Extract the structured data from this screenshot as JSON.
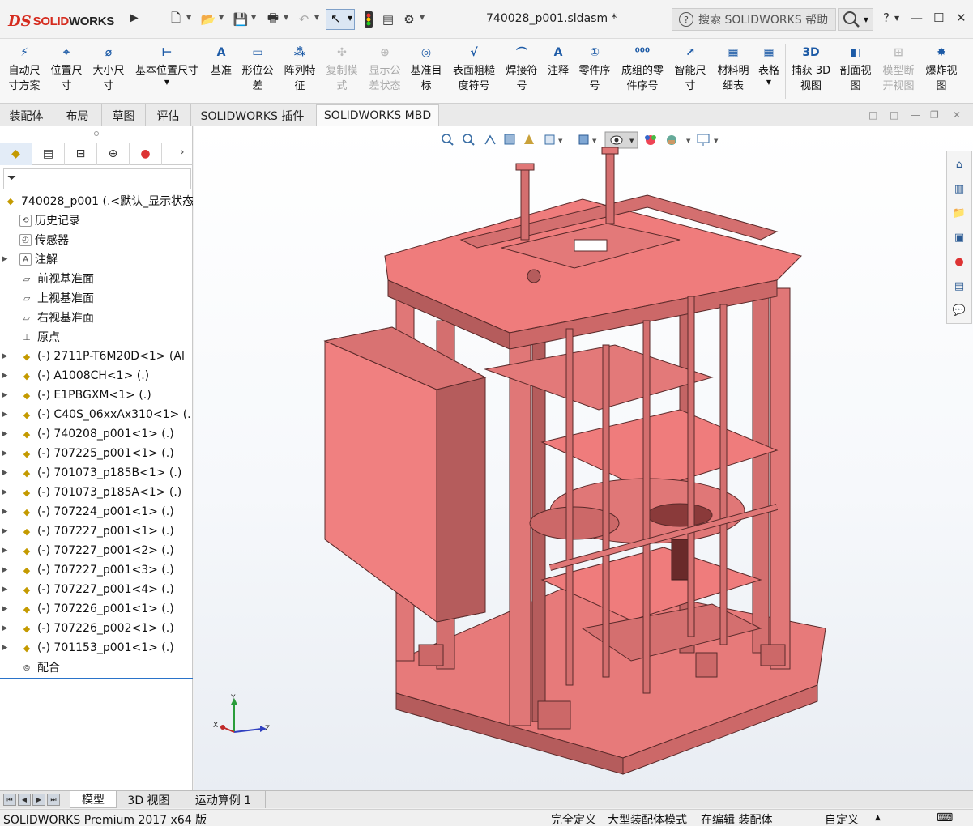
{
  "app": {
    "brand_prefix": "DS",
    "brand_solid": "SOLID",
    "brand_works": "WORKS"
  },
  "title_bar": {
    "document_title": "740028_p001.sldasm *",
    "search_placeholder": "搜索 SOLIDWORKS 帮助",
    "help": "?",
    "minimize": "—",
    "maximize": "☐",
    "close": "✕"
  },
  "ribbon": {
    "buttons": [
      {
        "label": "自动尺\n寸方案",
        "icon": "auto-dimension-icon",
        "enabled": true
      },
      {
        "label": "位置尺\n寸",
        "icon": "location-dimension-icon",
        "enabled": true
      },
      {
        "label": "大小尺\n寸",
        "icon": "size-dimension-icon",
        "enabled": true
      },
      {
        "label": "基本位置尺寸",
        "icon": "basic-location-dimension-icon",
        "enabled": true
      },
      {
        "label": "基准",
        "icon": "datum-icon",
        "enabled": true
      },
      {
        "label": "形位公\n差",
        "icon": "geometric-tolerance-icon",
        "enabled": true
      },
      {
        "label": "阵列特\n征",
        "icon": "pattern-feature-icon",
        "enabled": true
      },
      {
        "label": "复制模\n式",
        "icon": "copy-scheme-icon",
        "enabled": false
      },
      {
        "label": "显示公\n差状态",
        "icon": "show-tolerance-status-icon",
        "enabled": false
      },
      {
        "label": "基准目\n标",
        "icon": "datum-target-icon",
        "enabled": true
      },
      {
        "label": "表面粗糙\n度符号",
        "icon": "surface-finish-icon",
        "enabled": true
      },
      {
        "label": "焊接符\n号",
        "icon": "weld-symbol-icon",
        "enabled": true
      },
      {
        "label": "注释",
        "icon": "note-icon",
        "enabled": true
      },
      {
        "label": "零件序\n号",
        "icon": "balloon-icon",
        "enabled": true
      },
      {
        "label": "成组的零\n件序号",
        "icon": "stacked-balloon-icon",
        "enabled": true
      },
      {
        "label": "智能尺\n寸",
        "icon": "smart-dimension-icon",
        "enabled": true
      },
      {
        "label": "材料明\n细表",
        "icon": "bom-icon",
        "enabled": true
      },
      {
        "label": "表格",
        "icon": "table-icon",
        "enabled": true
      },
      {
        "label": "捕获 3D\n视图",
        "icon": "capture-3d-view-icon",
        "enabled": true
      },
      {
        "label": "剖面视\n图",
        "icon": "section-view-icon",
        "enabled": true
      },
      {
        "label": "模型断\n开视图",
        "icon": "model-break-view-icon",
        "enabled": false
      },
      {
        "label": "爆炸视\n图",
        "icon": "exploded-view-icon",
        "enabled": true
      }
    ]
  },
  "tabs": [
    {
      "label": "装配体",
      "active": false
    },
    {
      "label": "布局",
      "active": false
    },
    {
      "label": "草图",
      "active": false
    },
    {
      "label": "评估",
      "active": false
    },
    {
      "label": "SOLIDWORKS 插件",
      "active": false
    },
    {
      "label": "SOLIDWORKS MBD",
      "active": true
    }
  ],
  "feature_tree": {
    "root": "740028_p001  (.<默认_显示状态",
    "items": [
      {
        "label": "历史记录",
        "type": "history",
        "expandable": false
      },
      {
        "label": "传感器",
        "type": "sensor",
        "expandable": false
      },
      {
        "label": "注解",
        "type": "annotation",
        "expandable": true
      },
      {
        "label": "前视基准面",
        "type": "plane",
        "expandable": false
      },
      {
        "label": "上视基准面",
        "type": "plane",
        "expandable": false
      },
      {
        "label": "右视基准面",
        "type": "plane",
        "expandable": false
      },
      {
        "label": "原点",
        "type": "origin",
        "expandable": false
      },
      {
        "label": "(-) 2711P-T6M20D<1> (Al",
        "type": "part",
        "expandable": true
      },
      {
        "label": "(-) A1008CH<1> (.)",
        "type": "part",
        "expandable": true
      },
      {
        "label": "(-) E1PBGXM<1> (.)",
        "type": "part",
        "expandable": true
      },
      {
        "label": "(-) C40S_06xxAx310<1> (.",
        "type": "part",
        "expandable": true
      },
      {
        "label": "(-) 740208_p001<1> (.)",
        "type": "part",
        "expandable": true
      },
      {
        "label": "(-) 707225_p001<1> (.)",
        "type": "part",
        "expandable": true
      },
      {
        "label": "(-) 701073_p185B<1> (.)",
        "type": "part",
        "expandable": true
      },
      {
        "label": "(-) 701073_p185A<1> (.)",
        "type": "part",
        "expandable": true
      },
      {
        "label": "(-) 707224_p001<1> (.)",
        "type": "part",
        "expandable": true
      },
      {
        "label": "(-) 707227_p001<1> (.)",
        "type": "part",
        "expandable": true
      },
      {
        "label": "(-) 707227_p001<2> (.)",
        "type": "part",
        "expandable": true
      },
      {
        "label": "(-) 707227_p001<3> (.)",
        "type": "part",
        "expandable": true
      },
      {
        "label": "(-) 707227_p001<4> (.)",
        "type": "part",
        "expandable": true
      },
      {
        "label": "(-) 707226_p001<1> (.)",
        "type": "part",
        "expandable": true
      },
      {
        "label": "(-) 707226_p002<1> (.)",
        "type": "part",
        "expandable": true
      },
      {
        "label": "(-) 701153_p001<1> (.)",
        "type": "part",
        "expandable": true
      },
      {
        "label": "配合",
        "type": "mates",
        "expandable": false
      }
    ]
  },
  "triad": {
    "x": "X",
    "y": "Y",
    "z": "Z"
  },
  "bottom_tabs": [
    {
      "label": "模型",
      "active": true
    },
    {
      "label": "3D 视图",
      "active": false
    },
    {
      "label": "运动算例 1",
      "active": false
    }
  ],
  "status_bar": {
    "product": "SOLIDWORKS Premium 2017 x64 版",
    "definition": "完全定义",
    "mode": "大型装配体模式",
    "editing": "在编辑 装配体",
    "units": "自定义"
  },
  "colors": {
    "model_fill": "#f07878",
    "model_dark": "#b85a5a",
    "brand_red": "#d52b1e",
    "accent_blue": "#2a73c9"
  }
}
